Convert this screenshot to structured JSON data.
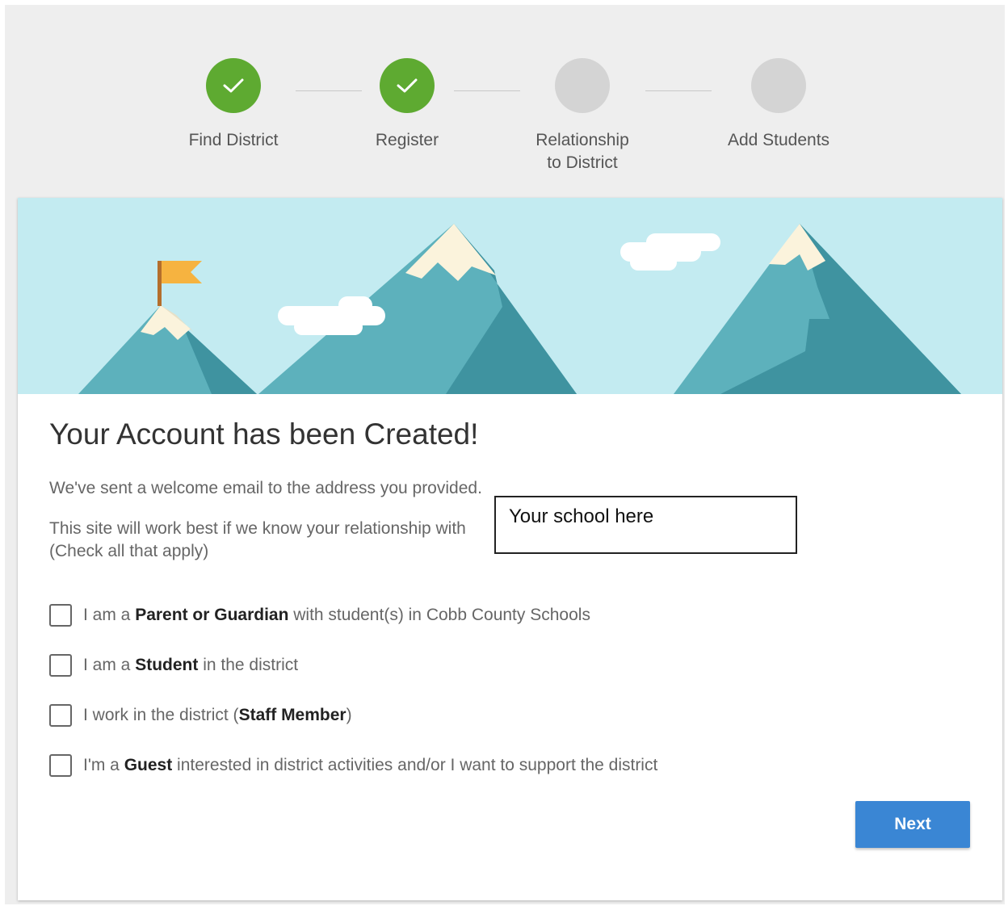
{
  "stepper": {
    "steps": [
      {
        "label_line1": "Find District",
        "label_line2": "",
        "status": "complete"
      },
      {
        "label_line1": "Register",
        "label_line2": "",
        "status": "complete"
      },
      {
        "label_line1": "Relationship",
        "label_line2": "to District",
        "status": "incomplete"
      },
      {
        "label_line1": "Add Students",
        "label_line2": "",
        "status": "incomplete"
      }
    ]
  },
  "content": {
    "title": "Your Account has been Created!",
    "email_notice": "We've sent a welcome email to the address you provided.",
    "relationship_prompt": "This site will work best if we know your relationship with",
    "check_hint": "(Check all that apply)",
    "school_placeholder": "Your school here"
  },
  "options": [
    {
      "prefix": "I am a ",
      "bold": "Parent or Guardian",
      "suffix": " with student(s) in Cobb County Schools",
      "checked": false
    },
    {
      "prefix": "I am a ",
      "bold": "Student",
      "suffix": " in the district",
      "checked": false
    },
    {
      "prefix": "I work in the district (",
      "bold": "Staff Member",
      "suffix": ")",
      "checked": false
    },
    {
      "prefix": "I'm a ",
      "bold": "Guest",
      "suffix": " interested in district activities and/or I want to support the district",
      "checked": false
    }
  ],
  "actions": {
    "next_label": "Next"
  },
  "colors": {
    "complete": "#5eaa31",
    "incomplete": "#d4d4d4",
    "primary_button": "#3a86d4",
    "sky": "#c3ebf1"
  }
}
